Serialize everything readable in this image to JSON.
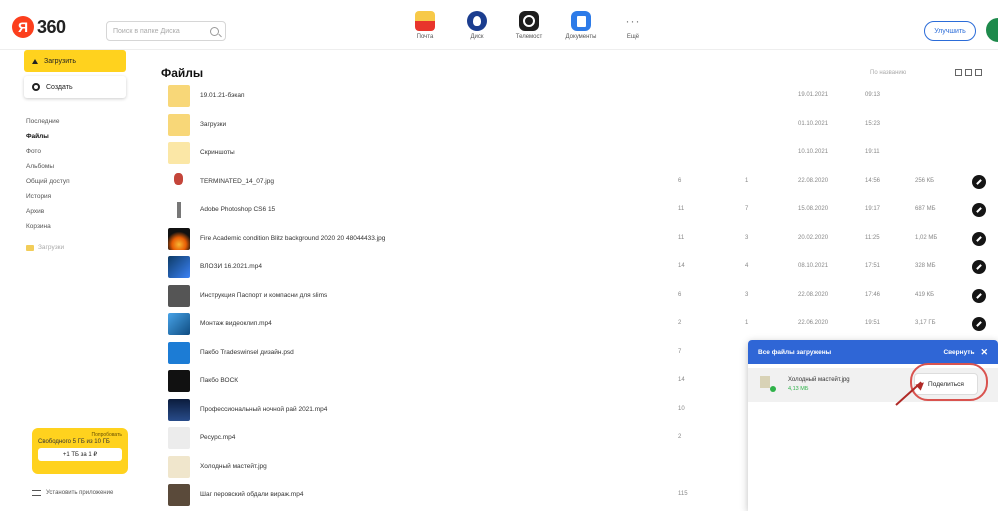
{
  "header": {
    "logo_ya": "Я",
    "logo_text": "360",
    "search_placeholder": "Поиск в папке Диска",
    "services": [
      {
        "label": "Почта",
        "icon": "mail-icon"
      },
      {
        "label": "Диск",
        "icon": "disk-icon"
      },
      {
        "label": "Телемост",
        "icon": "telemost-icon"
      },
      {
        "label": "Документы",
        "icon": "documents-icon"
      },
      {
        "label": "Ещё",
        "icon": "more-icon"
      }
    ],
    "upgrade_label": "Улучшить"
  },
  "sidebar": {
    "upload_label": "Загрузить",
    "create_label": "Создать",
    "items": [
      {
        "label": "Последние",
        "active": false
      },
      {
        "label": "Файлы",
        "active": true
      },
      {
        "label": "Фото",
        "active": false
      },
      {
        "label": "Альбомы",
        "active": false
      },
      {
        "label": "Общий доступ",
        "active": false
      },
      {
        "label": "История",
        "active": false
      },
      {
        "label": "Архив",
        "active": false
      },
      {
        "label": "Корзина",
        "active": false
      }
    ],
    "folder_label": "Загрузки",
    "promo_top": "Попробовать",
    "promo_text": "Свободного 5 ГБ из 10 ГБ",
    "promo_button": "+1 ТБ за 1 ₽",
    "install_label": "Установить приложение"
  },
  "main": {
    "title": "Файлы",
    "sort_label": "По названию"
  },
  "files": [
    {
      "name": "19.01.21-бэкап",
      "views": "",
      "downloads": "",
      "date": "19.01.2021",
      "time": "09:13",
      "size": "",
      "shared": false
    },
    {
      "name": "Загрузки",
      "views": "",
      "downloads": "",
      "date": "01.10.2021",
      "time": "15:23",
      "size": "",
      "shared": false
    },
    {
      "name": "Скриншоты",
      "views": "",
      "downloads": "",
      "date": "10.10.2021",
      "time": "19:11",
      "size": "",
      "shared": false
    },
    {
      "name": "TERMINATED_14_07.jpg",
      "views": "6",
      "downloads": "1",
      "date": "22.08.2020",
      "time": "14:56",
      "size": "256 КБ",
      "shared": true
    },
    {
      "name": "Adobe Photoshop CS6 15",
      "views": "11",
      "downloads": "7",
      "date": "15.08.2020",
      "time": "19:17",
      "size": "687 МБ",
      "shared": true
    },
    {
      "name": "Fire Academic condition Blitz background 2020 20 48044433.jpg",
      "views": "11",
      "downloads": "3",
      "date": "20.02.2020",
      "time": "11:25",
      "size": "1,02 МБ",
      "shared": true
    },
    {
      "name": "ВЛОЗИ 16.2021.mp4",
      "views": "14",
      "downloads": "4",
      "date": "08.10.2021",
      "time": "17:51",
      "size": "328 МБ",
      "shared": true
    },
    {
      "name": "Инструкция Паспорт и компасни для slims",
      "views": "6",
      "downloads": "3",
      "date": "22.08.2020",
      "time": "17:46",
      "size": "419 КБ",
      "shared": true
    },
    {
      "name": "Монтаж видеоклип.mp4",
      "views": "2",
      "downloads": "1",
      "date": "22.06.2020",
      "time": "19:51",
      "size": "3,17 ГБ",
      "shared": true
    },
    {
      "name": "Пакбо Tradeswinsel дизайн.psd",
      "views": "7",
      "downloads": "",
      "date": "",
      "time": "",
      "size": "",
      "shared": false
    },
    {
      "name": "Пакбо ВОСК",
      "views": "14",
      "downloads": "",
      "date": "",
      "time": "",
      "size": "",
      "shared": false
    },
    {
      "name": "Профессиональный ночной рай 2021.mp4",
      "views": "10",
      "downloads": "",
      "date": "",
      "time": "",
      "size": "",
      "shared": false
    },
    {
      "name": "Ресурс.mp4",
      "views": "2",
      "downloads": "",
      "date": "",
      "time": "",
      "size": "",
      "shared": false
    },
    {
      "name": "Холодный мастейт.jpg",
      "views": "",
      "downloads": "",
      "date": "",
      "time": "",
      "size": "",
      "shared": false
    },
    {
      "name": "Шаг перовский обдали вираж.mp4",
      "views": "115",
      "downloads": "",
      "date": "",
      "time": "",
      "size": "",
      "shared": false
    }
  ],
  "upload_panel": {
    "title": "Все файлы загружены",
    "hide_label": "Свернуть",
    "close_glyph": "✕",
    "item_name": "Холодный мастейт.jpg",
    "item_size": "4,13 МБ",
    "share_label": "Поделиться"
  },
  "colors": {
    "accent_yellow": "#ffd21e",
    "brand_red": "#fc3f1d",
    "panel_blue": "#2f66d6",
    "annotation_red": "#d9534f"
  }
}
